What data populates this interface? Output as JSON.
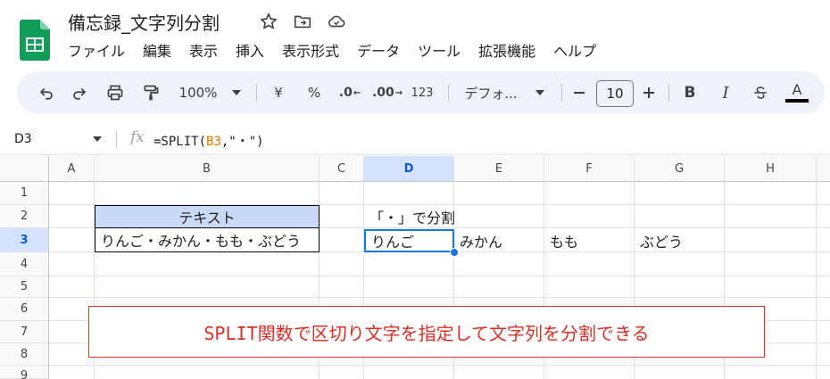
{
  "app": {
    "doc_title": "備忘録_文字列分割"
  },
  "menu": [
    "ファイル",
    "編集",
    "表示",
    "挿入",
    "表示形式",
    "データ",
    "ツール",
    "拡張機能",
    "ヘルプ"
  ],
  "toolbar": {
    "zoom": "100%",
    "currency": "¥",
    "percent": "%",
    "decrease_decimal": ".0",
    "increase_decimal": ".00",
    "number_format": "123",
    "font": "デフォ...",
    "font_size": "10",
    "bold": "B",
    "italic": "I",
    "text_color": "A"
  },
  "formula_bar": {
    "cell_ref": "D3",
    "fx": "fx",
    "formula_prefix": "=SPLIT(",
    "formula_ref": "B3",
    "formula_suffix": ",\"・\")"
  },
  "grid": {
    "columns": [
      "A",
      "B",
      "C",
      "D",
      "E",
      "F",
      "G",
      "H"
    ],
    "rows": [
      "1",
      "2",
      "3",
      "4",
      "5",
      "6",
      "7",
      "8",
      "9"
    ],
    "selected_column": "D",
    "selected_row": "3",
    "cells": {
      "B2": "テキスト",
      "B3": "りんご・みかん・もも・ぶどう",
      "D2": "「・」で分割",
      "D3": "りんご",
      "E3": "みかん",
      "F3": "もも",
      "G3": "ぶどう"
    }
  },
  "callout": "SPLIT関数で区切り文字を指定して文字列を分割できる",
  "colors": {
    "accent": "#1a73e8",
    "header_fill": "#c9daf8",
    "callout": "#d93025",
    "sheets_green": "#0f9d58"
  }
}
